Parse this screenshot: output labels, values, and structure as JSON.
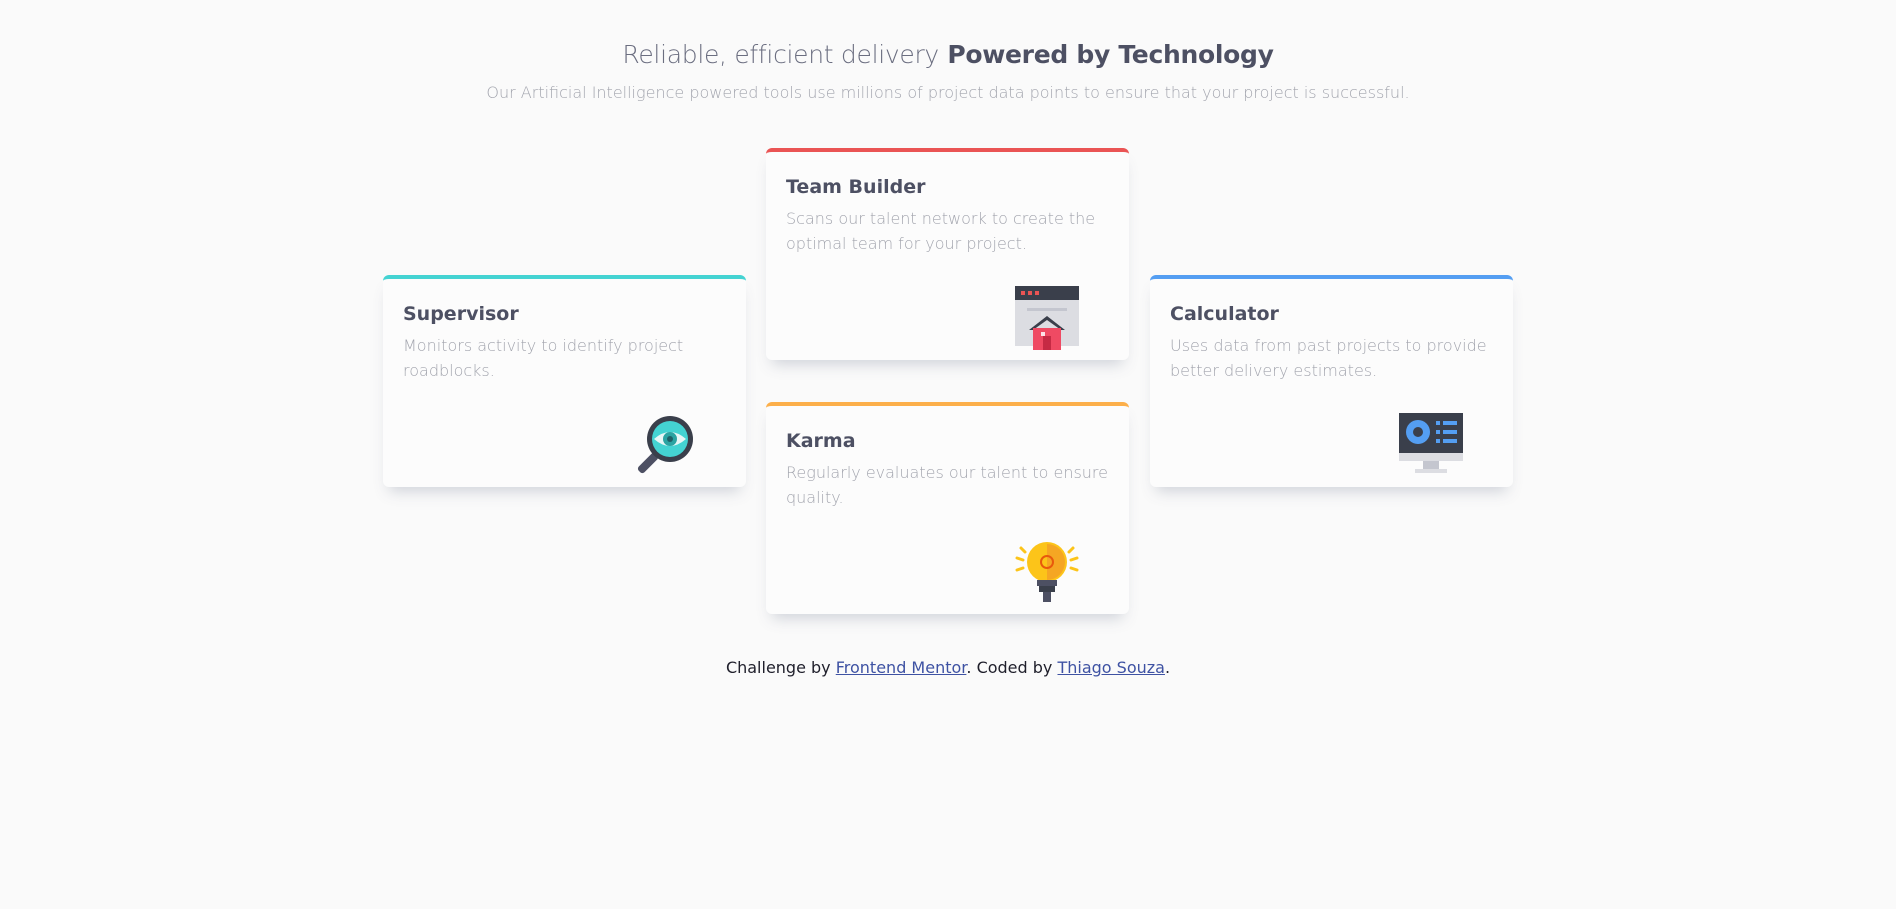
{
  "header": {
    "title_light": "Reliable, efficient delivery",
    "title_bold": "Powered by Technology",
    "subtitle": "Our Artificial Intelligence powered tools use millions of project data points to ensure that your project is successful."
  },
  "cards": [
    {
      "title": "Supervisor",
      "text": "Monitors activity to identify project roadblocks.",
      "accent": "#44d3d2",
      "icon": "magnifier-eye-icon"
    },
    {
      "title": "Team Builder",
      "text": "Scans our talent network to create the optimal team for your project.",
      "accent": "#ea5454",
      "icon": "team-builder-icon"
    },
    {
      "title": "Karma",
      "text": "Regularly evaluates our talent to ensure quality.",
      "accent": "#fcaf4a",
      "icon": "lightbulb-icon"
    },
    {
      "title": "Calculator",
      "text": "Uses data from past projects to provide better delivery estimates.",
      "accent": "#549ef2",
      "icon": "monitor-icon"
    }
  ],
  "footer": {
    "prefix": "Challenge by",
    "link1": "Frontend Mentor",
    "middle": ". Coded by",
    "link2": "Thiago Souza",
    "suffix": "."
  }
}
